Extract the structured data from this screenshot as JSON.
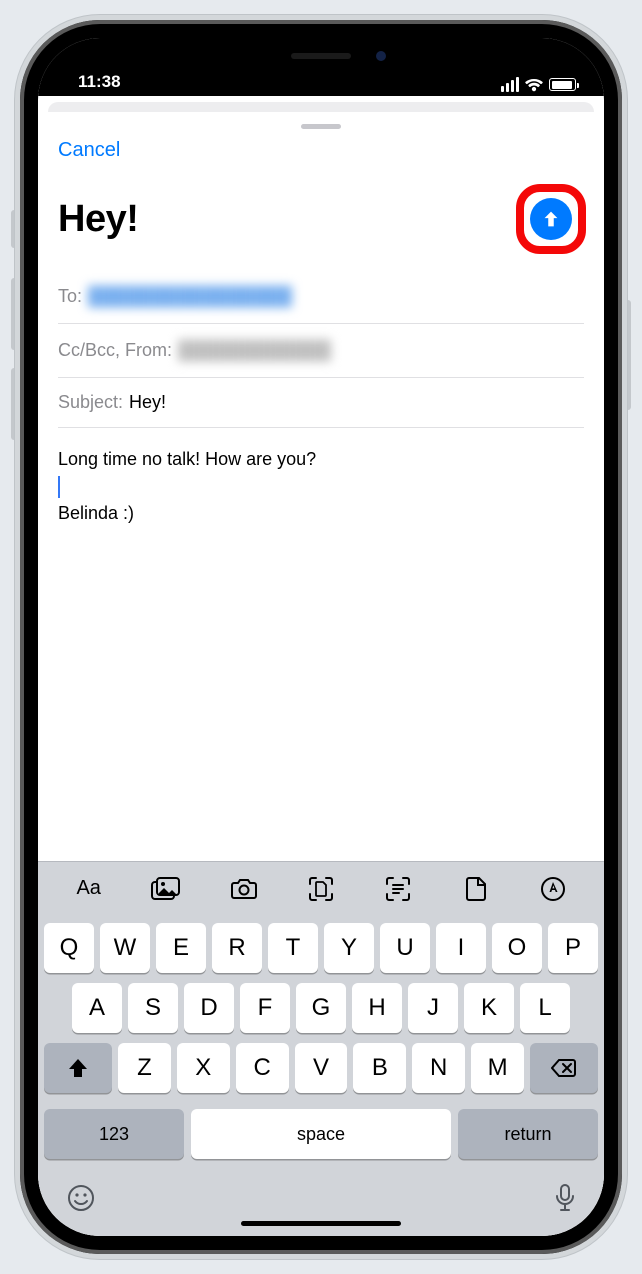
{
  "status": {
    "time": "11:38"
  },
  "nav": {
    "cancel": "Cancel"
  },
  "compose": {
    "title": "Hey!",
    "to_label": "To:",
    "to_value": "████████████████",
    "ccbcc_label": "Cc/Bcc, From:",
    "from_value": "████████████",
    "subject_label": "Subject:",
    "subject_value": "Hey!",
    "body_line1": "Long time no talk! How are you?",
    "body_line2": "",
    "body_line3": "Belinda :)"
  },
  "keyboard": {
    "row1": [
      "Q",
      "W",
      "E",
      "R",
      "T",
      "Y",
      "U",
      "I",
      "O",
      "P"
    ],
    "row2": [
      "A",
      "S",
      "D",
      "F",
      "G",
      "H",
      "J",
      "K",
      "L"
    ],
    "row3": [
      "Z",
      "X",
      "C",
      "V",
      "B",
      "N",
      "M"
    ],
    "k123": "123",
    "space": "space",
    "return": "return"
  },
  "annotation": {
    "highlight": "send-button"
  }
}
